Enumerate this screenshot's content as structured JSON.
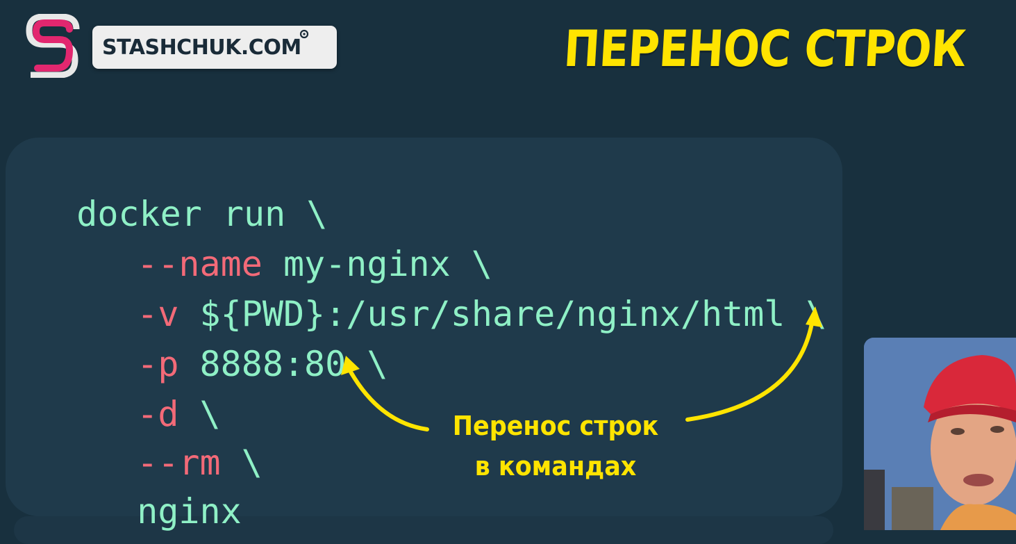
{
  "brand": {
    "domain": "STASHCHUK.COM"
  },
  "title": "ПЕРЕНОС СТРОК",
  "code": {
    "lines": [
      {
        "flag": "",
        "arg": "docker run \\"
      },
      {
        "flag": "--name",
        "arg": " my-nginx \\"
      },
      {
        "flag": "-v",
        "arg": " ${PWD}:/usr/share/nginx/html \\"
      },
      {
        "flag": "-p",
        "arg": " 8888:80 \\"
      },
      {
        "flag": "-d",
        "arg": " \\"
      },
      {
        "flag": "--rm",
        "arg": " \\"
      },
      {
        "flag": "",
        "arg": "nginx"
      }
    ]
  },
  "annotation": {
    "line1": "Перенос строк",
    "line2": "в командах"
  },
  "colors": {
    "background": "#18303e",
    "panel": "#1f3a4b",
    "title": "#ffe400",
    "command": "#8ff0c6",
    "flag": "#f36a78",
    "annotation": "#ffe400",
    "logo_pink": "#e2276f",
    "logo_light": "#e8e8e8"
  },
  "icons": {
    "logo": "stashchuk-s-logo-icon",
    "arrow_left": "curved-arrow-up-icon",
    "arrow_right": "curved-arrow-up-icon"
  }
}
